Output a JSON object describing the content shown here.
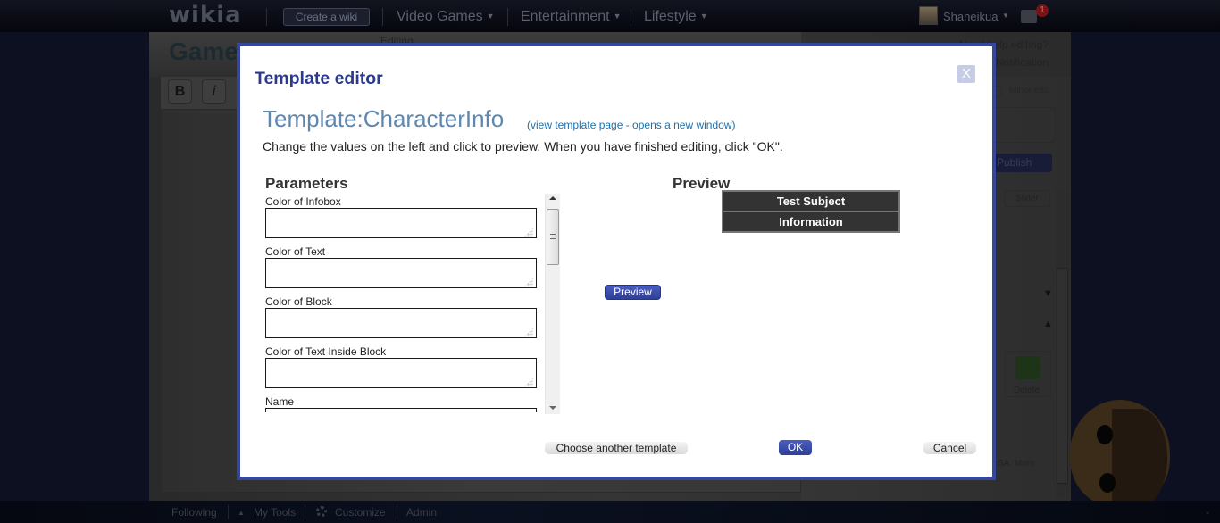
{
  "global_nav": {
    "logo": "wikia",
    "create_wiki": "Create a wiki",
    "hubs": [
      {
        "label": "Video Games"
      },
      {
        "label": "Entertainment"
      },
      {
        "label": "Lifestyle"
      }
    ],
    "user_name": "Shaneikua",
    "notification_count": "1"
  },
  "background_page": {
    "title": "Game",
    "editing_label": "Editing",
    "toolbar": {
      "bold": "B",
      "italic": "i"
    },
    "rail": {
      "help": "Need help editing?",
      "notification": "Notification",
      "minor_edit": "Minor edit",
      "publish": "Publish",
      "slider": "Slider",
      "delete": "Delete",
      "more": "SA. More"
    }
  },
  "bottom_toolbar": {
    "following": "Following",
    "my_tools": "My Tools",
    "customize": "Customize",
    "admin": "Admin"
  },
  "modal": {
    "title": "Template editor",
    "close_label": "X",
    "template_name": "Template:CharacterInfo",
    "template_link": "(view template page - opens a new window)",
    "instructions": "Change the values on the left and click to preview. When you have finished editing, click \"OK\".",
    "parameters_heading": "Parameters",
    "parameters": [
      {
        "label": "Color of Infobox",
        "value": ""
      },
      {
        "label": "Color of Text",
        "value": ""
      },
      {
        "label": "Color of Block",
        "value": ""
      },
      {
        "label": "Color of Text Inside Block",
        "value": ""
      },
      {
        "label": "Name",
        "value": ""
      }
    ],
    "preview_button": "Preview",
    "preview_heading": "Preview",
    "preview_infobox": {
      "rows": [
        "Test Subject",
        "Information"
      ],
      "colors": {
        "row_bg": "#333333",
        "border": "#777777",
        "text": "#ffffff"
      }
    },
    "buttons": {
      "choose_another": "Choose another template",
      "ok": "OK",
      "cancel": "Cancel"
    },
    "colors": {
      "frame": "#36479b",
      "title": "#2b3a8c",
      "template_name": "#5f88b0",
      "link": "#1f6fa8"
    }
  }
}
